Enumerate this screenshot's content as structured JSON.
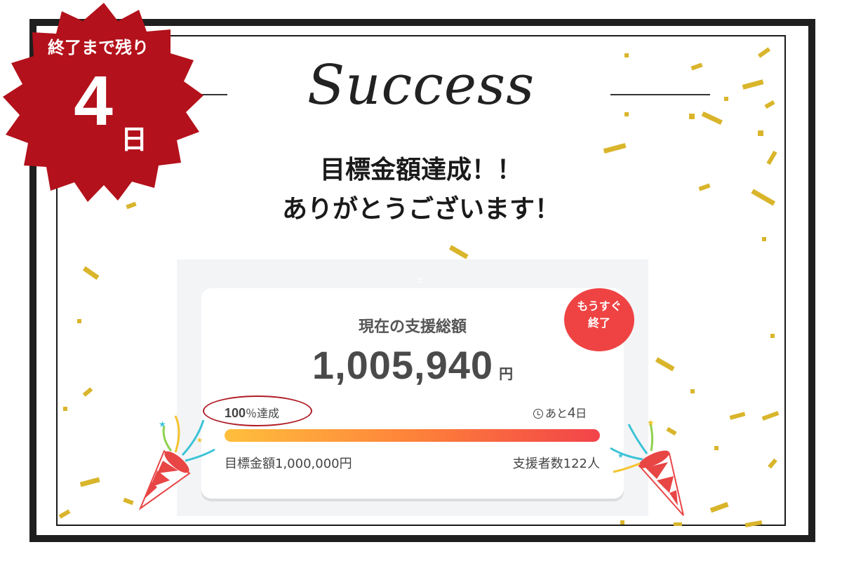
{
  "badge": {
    "top_text": "終了まで残り",
    "days": "4",
    "unit": "日",
    "color": "#b3111b"
  },
  "title": "Success",
  "headline": {
    "line1": "目標金額達成！！",
    "line2": "ありがとうございます！"
  },
  "card": {
    "heading": "現在の支援総額",
    "amount": "1,005,940",
    "amount_unit": "円",
    "soon_badge": {
      "line1": "もうすぐ",
      "line2": "終了",
      "color": "#ef4343"
    },
    "percent_value": "100",
    "percent_suffix": "％達成",
    "remaining_prefix": "あと",
    "remaining_days": "4",
    "remaining_unit": "日",
    "progress_fraction": 1.0,
    "goal_label": "目標金額1,000,000円",
    "backers_label": "支援者数122人"
  },
  "colors": {
    "confetti_gold": "#d9b52b",
    "progress_start": "#ffbf3c",
    "progress_end": "#f2434a"
  }
}
